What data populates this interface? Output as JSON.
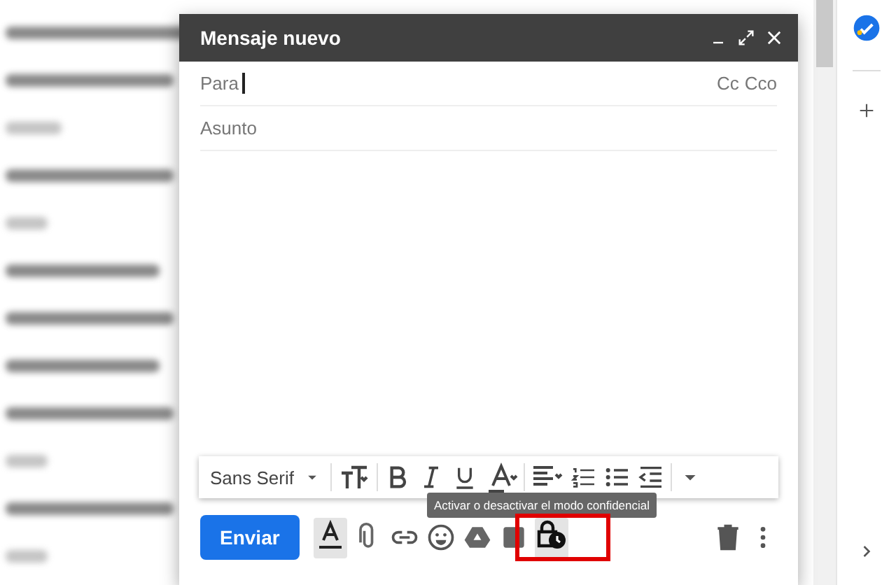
{
  "compose": {
    "title": "Mensaje nuevo",
    "to_field": {
      "label": "Para",
      "cc": "Cc",
      "bcc": "Cco"
    },
    "subject_field": {
      "placeholder": "Asunto"
    },
    "formatting_toolbar": {
      "font": "Sans Serif"
    },
    "tooltip": "Activar o desactivar el modo confidencial",
    "send_button": "Enviar"
  }
}
